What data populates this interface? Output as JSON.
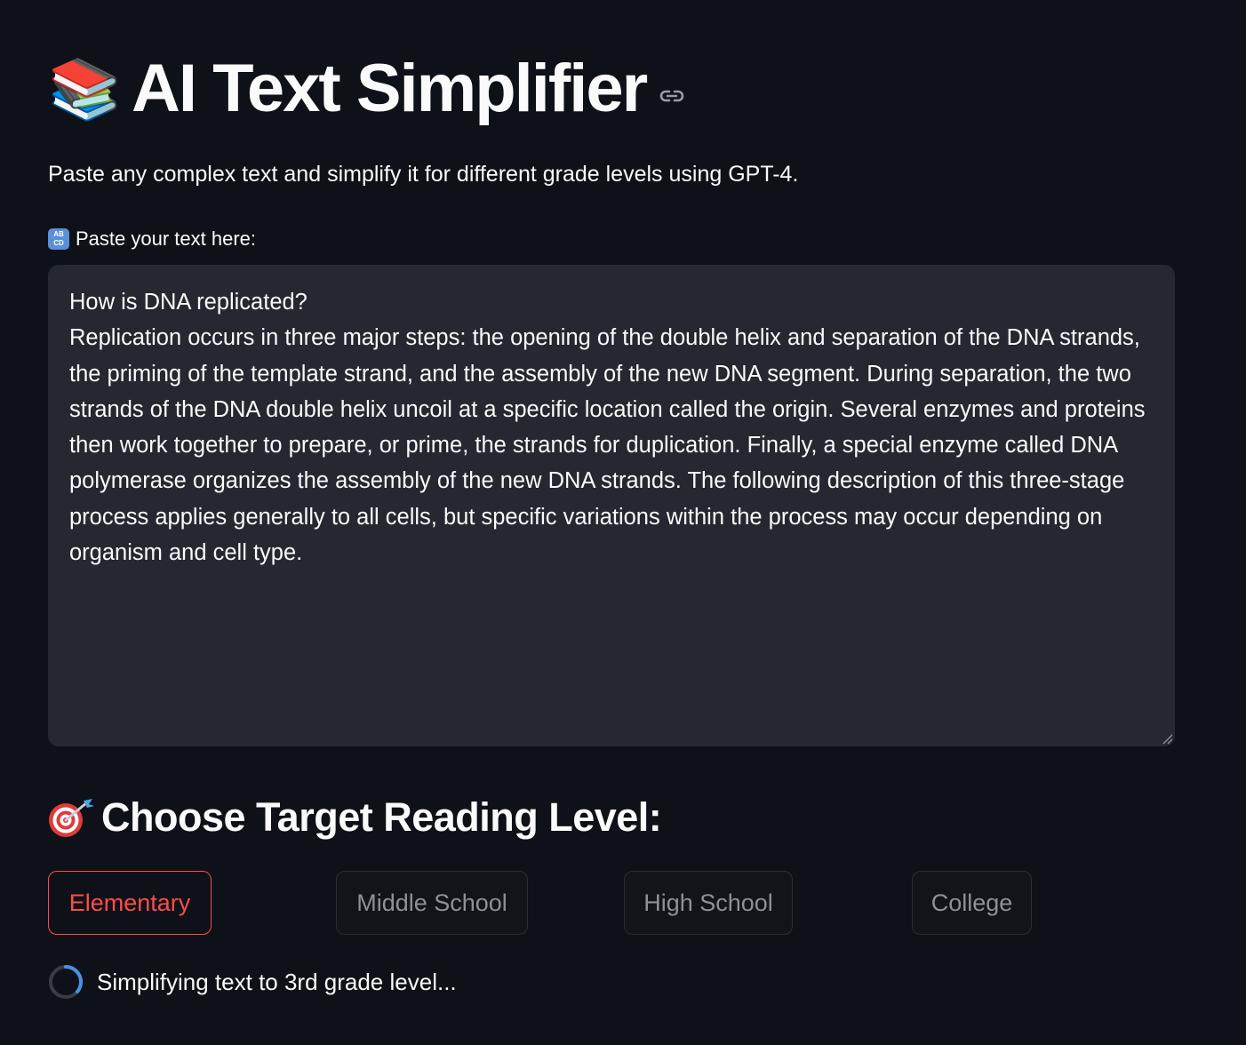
{
  "header": {
    "title_emoji": "📚",
    "title": "AI Text Simplifier",
    "anchor_icon": "link-icon"
  },
  "subtitle": "Paste any complex text and simplify it for different grade levels using GPT-4.",
  "input": {
    "label_icon": "abcd-icon",
    "label": "Paste your text here:",
    "value": "How is DNA replicated?\nReplication occurs in three major steps: the opening of the double helix and separation of the DNA strands, the priming of the template strand, and the assembly of the new DNA segment. During separation, the two strands of the DNA double helix uncoil at a specific location called the origin. Several enzymes and proteins then work together to prepare, or prime, the strands for duplication. Finally, a special enzyme called DNA polymerase organizes the assembly of the new DNA strands. The following description of this three-stage process applies generally to all cells, but specific variations within the process may occur depending on organism and cell type."
  },
  "reading_level": {
    "heading_icon": "target-icon",
    "heading": "Choose Target Reading Level:",
    "options": [
      {
        "label": "Elementary",
        "active": true
      },
      {
        "label": "Middle School",
        "active": false
      },
      {
        "label": "High School",
        "active": false
      },
      {
        "label": "College",
        "active": false
      }
    ]
  },
  "status": {
    "icon": "spinner-icon",
    "text": "Simplifying text to 3rd grade level..."
  },
  "colors": {
    "background": "#0e1117",
    "surface": "#262730",
    "text": "#fafafa",
    "accent": "#ff4b4b",
    "muted": "#8e9099",
    "spinner_accent": "#4a90e2"
  }
}
